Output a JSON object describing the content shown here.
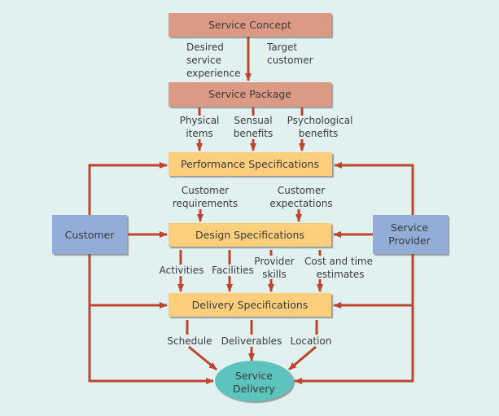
{
  "colors": {
    "background": "#e1f1ef",
    "concept": "#dc9a84",
    "spec": "#fdcf7b",
    "actor": "#93acd8",
    "delivery": "#5cc4bc",
    "arrow": "#c0442c"
  },
  "nodes": {
    "service_concept": "Service Concept",
    "service_package": "Service Package",
    "performance_specifications": "Performance Specifications",
    "design_specifications": "Design Specifications",
    "delivery_specifications": "Delivery Specifications",
    "customer": "Customer",
    "service_provider": [
      "Service",
      "Provider"
    ],
    "service_delivery": [
      "Service",
      "Delivery"
    ]
  },
  "edge_labels": {
    "desired_service_experience": [
      "Desired",
      "service",
      "experience"
    ],
    "target_customer": [
      "Target",
      "customer"
    ],
    "physical_items": [
      "Physical",
      "items"
    ],
    "sensual_benefits": [
      "Sensual",
      "benefits"
    ],
    "psychological_benefits": [
      "Psychological",
      "benefits"
    ],
    "customer_requirements": [
      "Customer",
      "requirements"
    ],
    "customer_expectations": [
      "Customer",
      "expectations"
    ],
    "activities": "Activities",
    "facilities": "Facilities",
    "provider_skills": [
      "Provider",
      "skills"
    ],
    "cost_time": [
      "Cost and time",
      "estimates"
    ],
    "schedule": "Schedule",
    "deliverables": "Deliverables",
    "location": "Location"
  }
}
